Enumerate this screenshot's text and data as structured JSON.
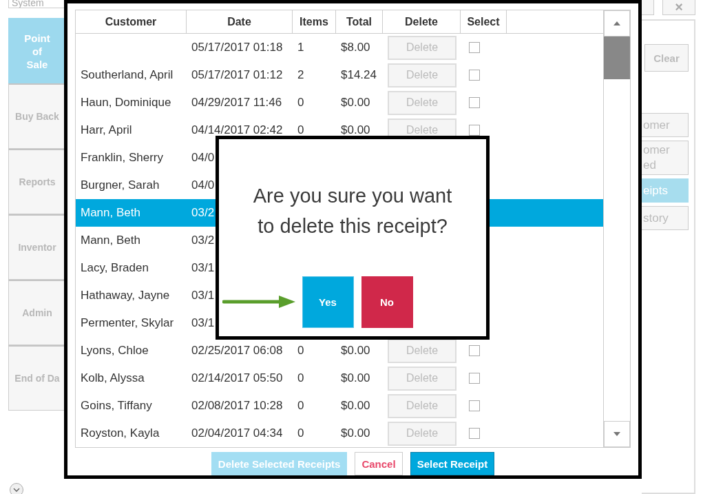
{
  "sidebar": {
    "search": {
      "value": "System"
    },
    "items": [
      {
        "label": "Point of Sale",
        "selected": true
      },
      {
        "label": "Buy Back",
        "selected": false
      },
      {
        "label": "Reports",
        "selected": false
      },
      {
        "label": "Inventor",
        "selected": false
      },
      {
        "label": "Admin",
        "selected": false
      },
      {
        "label": "End of Da",
        "selected": false
      }
    ]
  },
  "right_panel": {
    "close": "×",
    "clear": "Clear",
    "buttons": [
      {
        "label": "omer",
        "selected": false
      },
      {
        "label": "omer ed",
        "selected": false
      },
      {
        "label": "eipts",
        "selected": true
      },
      {
        "label": "story",
        "selected": false
      }
    ]
  },
  "table": {
    "columns": [
      "Customer",
      "Date",
      "Items",
      "Total",
      "Delete",
      "Select"
    ],
    "rows": [
      {
        "date": "05/17/2017 01:18",
        "items": "1",
        "total": "$8.00",
        "delete": "Delete",
        "checked": false,
        "selected": false
      },
      {
        "customer": "Southerland, April",
        "date": "05/17/2017 01:12",
        "items": "2",
        "total": "$14.24",
        "delete": "Delete",
        "checked": false,
        "selected": false
      },
      {
        "customer": "Haun, Dominique",
        "date": "04/29/2017 11:46",
        "items": "0",
        "total": "$0.00",
        "delete": "Delete",
        "checked": false,
        "selected": false
      },
      {
        "customer": "Harr, April",
        "date": "04/14/2017 02:42",
        "items": "0",
        "total": "$0.00",
        "delete": "Delete",
        "checked": false,
        "selected": false
      },
      {
        "customer": "Franklin, Sherry",
        "date": "04/0",
        "selected": false
      },
      {
        "customer": "Burgner, Sarah",
        "date": "04/0",
        "selected": false
      },
      {
        "customer": "Mann, Beth",
        "date": "03/2",
        "selected": true
      },
      {
        "customer": "Mann, Beth",
        "date": "03/2",
        "selected": false
      },
      {
        "customer": "Lacy, Braden",
        "date": "03/1",
        "selected": false
      },
      {
        "customer": "Hathaway, Jayne",
        "date": "03/1",
        "selected": false
      },
      {
        "customer": "Permenter, Skylar",
        "date": "03/1",
        "selected": false
      },
      {
        "customer": "Lyons, Chloe",
        "date": "02/25/2017 06:08",
        "items": "0",
        "total": "$0.00",
        "delete": "Delete",
        "checked": false,
        "selected": false
      },
      {
        "customer": "Kolb, Alyssa",
        "date": "02/14/2017 05:50",
        "items": "0",
        "total": "$0.00",
        "delete": "Delete",
        "checked": false,
        "selected": false
      },
      {
        "customer": "Goins, Tiffany",
        "date": "02/08/2017 10:28",
        "items": "0",
        "total": "$0.00",
        "delete": "Delete",
        "checked": false,
        "selected": false
      },
      {
        "customer": "Royston, Kayla",
        "date": "02/04/2017 04:34",
        "items": "0",
        "total": "$0.00",
        "delete": "Delete",
        "checked": false,
        "selected": false
      }
    ]
  },
  "footer_buttons": [
    {
      "label": "Delete Selected Receipts",
      "kind": "disabled"
    },
    {
      "label": "Cancel",
      "kind": "cancel"
    },
    {
      "label": "Select Receipt",
      "kind": "primary"
    }
  ],
  "confirm": {
    "message": "Are you sure you want to delete this receipt?",
    "yes": "Yes",
    "no": "No"
  }
}
